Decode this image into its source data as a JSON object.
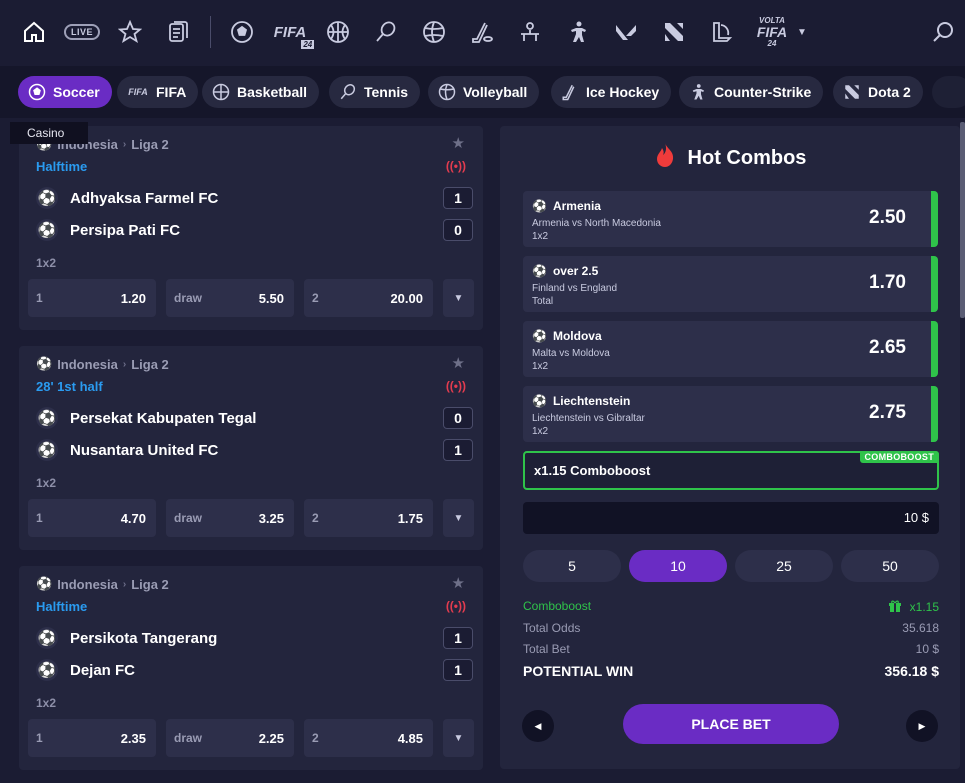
{
  "nav": {
    "live_label": "LIVE",
    "fifa_label": "FIFA",
    "fifa_year": "24",
    "volta_top": "VOLTA",
    "volta_main": "FIFA",
    "volta_year": "24"
  },
  "sports": [
    {
      "label": "Soccer",
      "icon": "soccer-icon"
    },
    {
      "label": "FIFA",
      "icon": "fifa-icon"
    },
    {
      "label": "Basketball",
      "icon": "basketball-icon"
    },
    {
      "label": "Tennis",
      "icon": "tennis-icon"
    },
    {
      "label": "Volleyball",
      "icon": "volleyball-icon"
    },
    {
      "label": "Ice Hockey",
      "icon": "ice-hockey-icon"
    },
    {
      "label": "Counter-Strike",
      "icon": "counter-strike-icon"
    },
    {
      "label": "Dota 2",
      "icon": "dota-icon"
    }
  ],
  "tooltip": "Casino",
  "matches": [
    {
      "country": "Indonesia",
      "league": "Liga 2",
      "status": "Halftime",
      "home": "Adhyaksa Farmel FC",
      "home_score": "1",
      "away": "Persipa Pati FC",
      "away_score": "0",
      "market": "1x2",
      "odds": [
        {
          "label": "1",
          "value": "1.20"
        },
        {
          "label": "draw",
          "value": "5.50"
        },
        {
          "label": "2",
          "value": "20.00"
        }
      ]
    },
    {
      "country": "Indonesia",
      "league": "Liga 2",
      "status": "28' 1st half",
      "home": "Persekat Kabupaten Tegal",
      "home_score": "0",
      "away": "Nusantara United FC",
      "away_score": "1",
      "market": "1x2",
      "odds": [
        {
          "label": "1",
          "value": "4.70"
        },
        {
          "label": "draw",
          "value": "3.25"
        },
        {
          "label": "2",
          "value": "1.75"
        }
      ]
    },
    {
      "country": "Indonesia",
      "league": "Liga 2",
      "status": "Halftime",
      "home": "Persikota Tangerang",
      "home_score": "1",
      "away": "Dejan FC",
      "away_score": "1",
      "market": "1x2",
      "odds": [
        {
          "label": "1",
          "value": "2.35"
        },
        {
          "label": "draw",
          "value": "2.25"
        },
        {
          "label": "2",
          "value": "4.85"
        }
      ]
    }
  ],
  "combos": {
    "title": "Hot Combos",
    "selections": [
      {
        "name": "Armenia",
        "match": "Armenia vs North Macedonia",
        "market": "1x2",
        "odd": "2.50"
      },
      {
        "name": "over 2.5",
        "match": "Finland vs England",
        "market": "Total",
        "odd": "1.70"
      },
      {
        "name": "Moldova",
        "match": "Malta vs Moldova",
        "market": "1x2",
        "odd": "2.65"
      },
      {
        "name": "Liechtenstein",
        "match": "Liechtenstein vs Gibraltar",
        "market": "1x2",
        "odd": "2.75"
      }
    ],
    "boost_label": "x1.15 Comboboost",
    "boost_tag": "COMBOBOOST",
    "stake": "10 $",
    "chips": [
      "5",
      "10",
      "25",
      "50"
    ],
    "selected_chip": "10",
    "comboboost_label": "Comboboost",
    "comboboost_value": "x1.15",
    "total_odds_label": "Total Odds",
    "total_odds_value": "35.618",
    "total_bet_label": "Total Bet",
    "total_bet_value": "10 $",
    "potential_win_label": "POTENTIAL WIN",
    "potential_win_value": "356.18 $",
    "place_bet_label": "PLACE BET"
  },
  "colors": {
    "background": "#1b1c33",
    "card": "#23253d",
    "accent_purple": "#6a2cc4",
    "status_blue": "#2a9bf0",
    "live_red": "#e33c4f",
    "boost_green": "#2fc34a"
  }
}
